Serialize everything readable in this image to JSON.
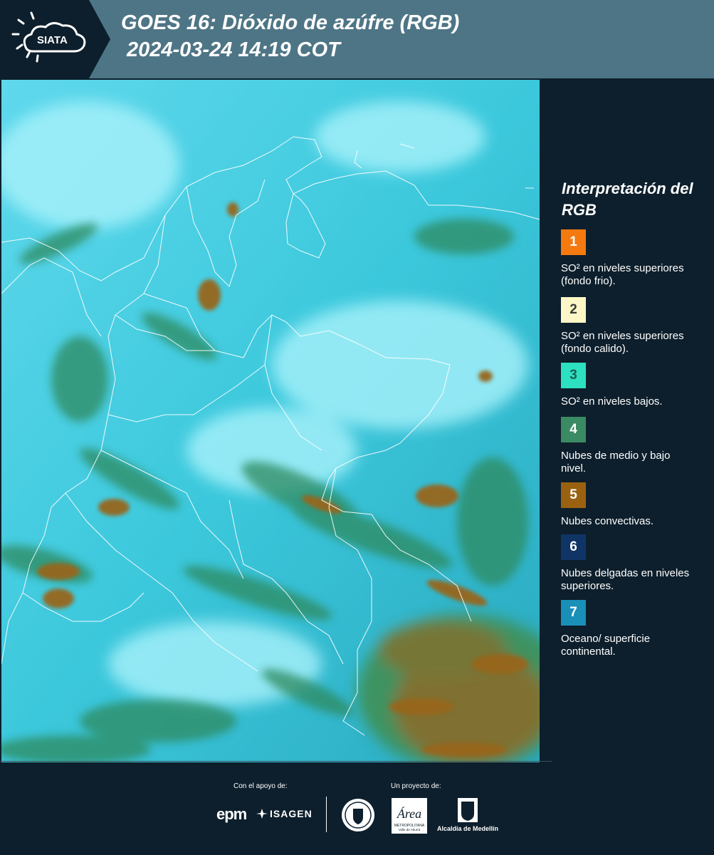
{
  "header": {
    "logo_text": "SIATA",
    "title_line1": "GOES 16: Dióxido de azúfre (RGB)",
    "title_line2": "2024-03-24 14:19 COT"
  },
  "legend": {
    "title": "Interpretación del RGB",
    "items": [
      {
        "number": "1",
        "label": "SO² en niveles superiores (fondo frio).",
        "color": "#f47a10"
      },
      {
        "number": "2",
        "label": "SO² en niveles superiores (fondo calido).",
        "color": "#fdf6c6"
      },
      {
        "number": "3",
        "label": "SO² en niveles bajos.",
        "color": "#2de0c0"
      },
      {
        "number": "4",
        "label": "Nubes de medio y bajo nivel.",
        "color": "#3a8a63"
      },
      {
        "number": "5",
        "label": "Nubes convectivas.",
        "color": "#9a6210"
      },
      {
        "number": "6",
        "label": "Nubes delgadas en niveles superiores.",
        "color": "#0f3466"
      },
      {
        "number": "7",
        "label": "Oceano/ superficie continental.",
        "color": "#1a8fb8"
      }
    ]
  },
  "footer": {
    "support_label": "Con el apoyo de:",
    "project_label": "Un proyecto de:",
    "epm": "epm",
    "isagen": "ISAGEN",
    "area_text": "Área",
    "area_sub": "METROPOLITANA",
    "area_sub2": "Valle de Aburrá",
    "alcaldia": "Alcaldía de Medellín"
  }
}
